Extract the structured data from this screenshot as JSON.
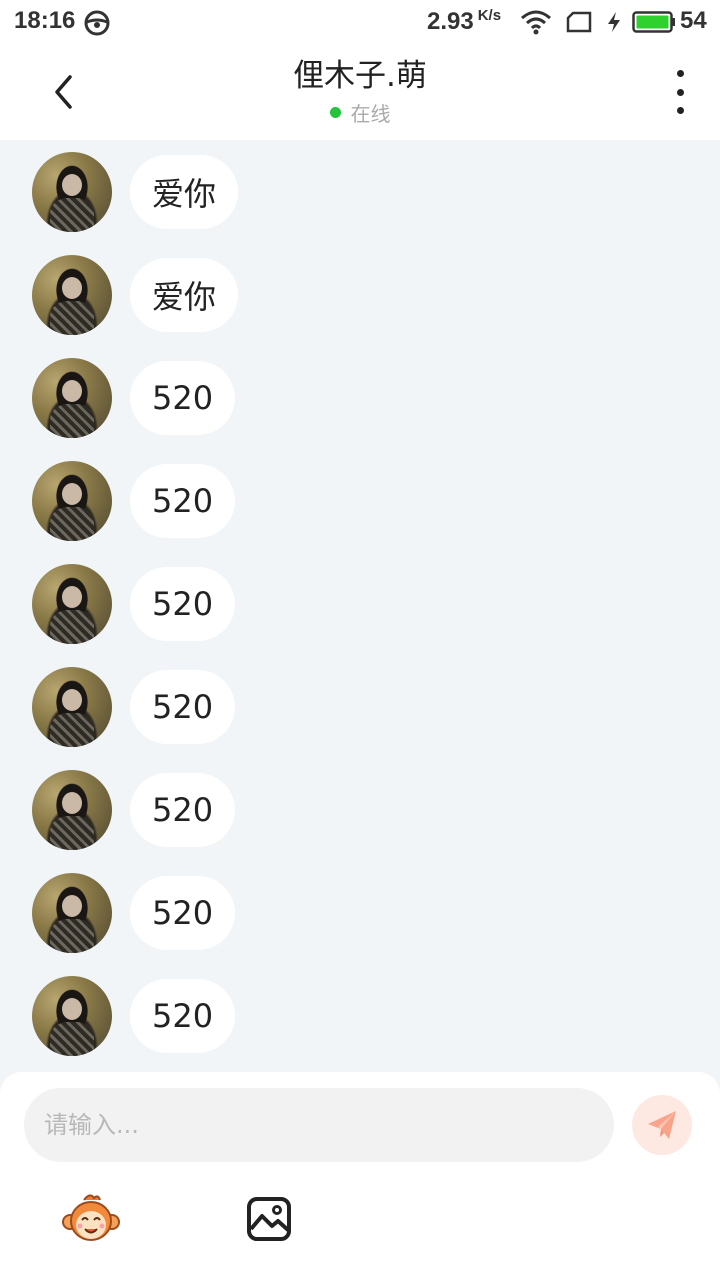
{
  "status_bar": {
    "time": "18:16",
    "net_speed": "2.93",
    "net_speed_unit": "K/s",
    "battery_level": "54",
    "battery_color": "#2fd12f",
    "icons": [
      "steering-wheel-icon",
      "wifi-icon",
      "sim-card-icon",
      "charging-icon",
      "battery-icon"
    ]
  },
  "header": {
    "title": "俚木子.萌",
    "presence": "在线",
    "presence_color": "#23c33b",
    "icons": [
      "back-arrow-icon",
      "more-vertical-icon"
    ]
  },
  "messages": [
    {
      "text": "爱你"
    },
    {
      "text": "爱你"
    },
    {
      "text": "520"
    },
    {
      "text": "520"
    },
    {
      "text": "520"
    },
    {
      "text": "520"
    },
    {
      "text": "520"
    },
    {
      "text": "520"
    },
    {
      "text": "520"
    }
  ],
  "composer": {
    "placeholder": "请输入...",
    "send_color": "#f8a48b",
    "icons": [
      "send-icon",
      "emoji-icon",
      "image-icon"
    ]
  }
}
